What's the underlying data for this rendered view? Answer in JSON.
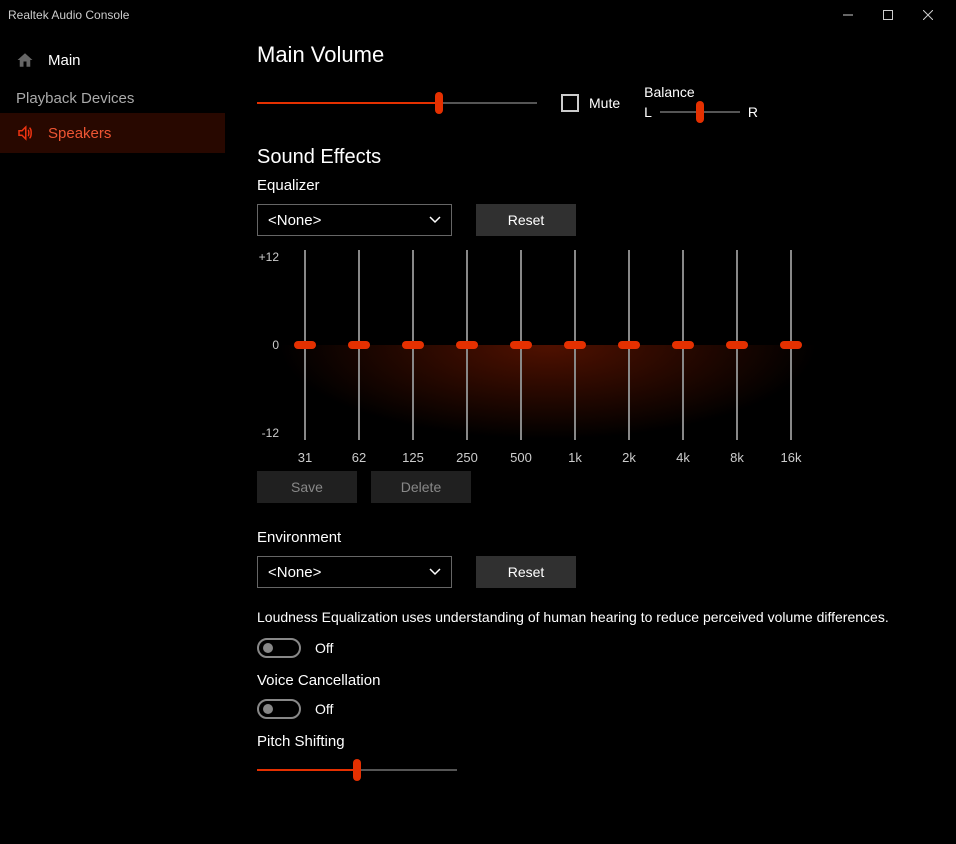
{
  "window": {
    "title": "Realtek Audio Console"
  },
  "sidebar": {
    "main_label": "Main",
    "playback_section": "Playback Devices",
    "speakers_label": "Speakers"
  },
  "main_volume": {
    "heading": "Main Volume",
    "value_pct": 65,
    "mute_label": "Mute",
    "mute_checked": false,
    "balance_label": "Balance",
    "balance_left": "L",
    "balance_right": "R",
    "balance_pct": 50
  },
  "sound_effects": {
    "heading": "Sound Effects",
    "equalizer": {
      "label": "Equalizer",
      "preset": "<None>",
      "reset_label": "Reset",
      "save_label": "Save",
      "delete_label": "Delete",
      "scale_top": "+12",
      "scale_mid": "0",
      "scale_bottom": "-12",
      "bands": [
        {
          "freq": "31",
          "value": 0
        },
        {
          "freq": "62",
          "value": 0
        },
        {
          "freq": "125",
          "value": 0
        },
        {
          "freq": "250",
          "value": 0
        },
        {
          "freq": "500",
          "value": 0
        },
        {
          "freq": "1k",
          "value": 0
        },
        {
          "freq": "2k",
          "value": 0
        },
        {
          "freq": "4k",
          "value": 0
        },
        {
          "freq": "8k",
          "value": 0
        },
        {
          "freq": "16k",
          "value": 0
        }
      ]
    },
    "environment": {
      "label": "Environment",
      "preset": "<None>",
      "reset_label": "Reset"
    },
    "loudness": {
      "desc": "Loudness Equalization uses understanding of human hearing to reduce perceived volume differences.",
      "state_label": "Off",
      "on": false
    },
    "voice_cancel": {
      "label": "Voice Cancellation",
      "state_label": "Off",
      "on": false
    },
    "pitch": {
      "label": "Pitch Shifting",
      "value_pct": 50
    }
  }
}
